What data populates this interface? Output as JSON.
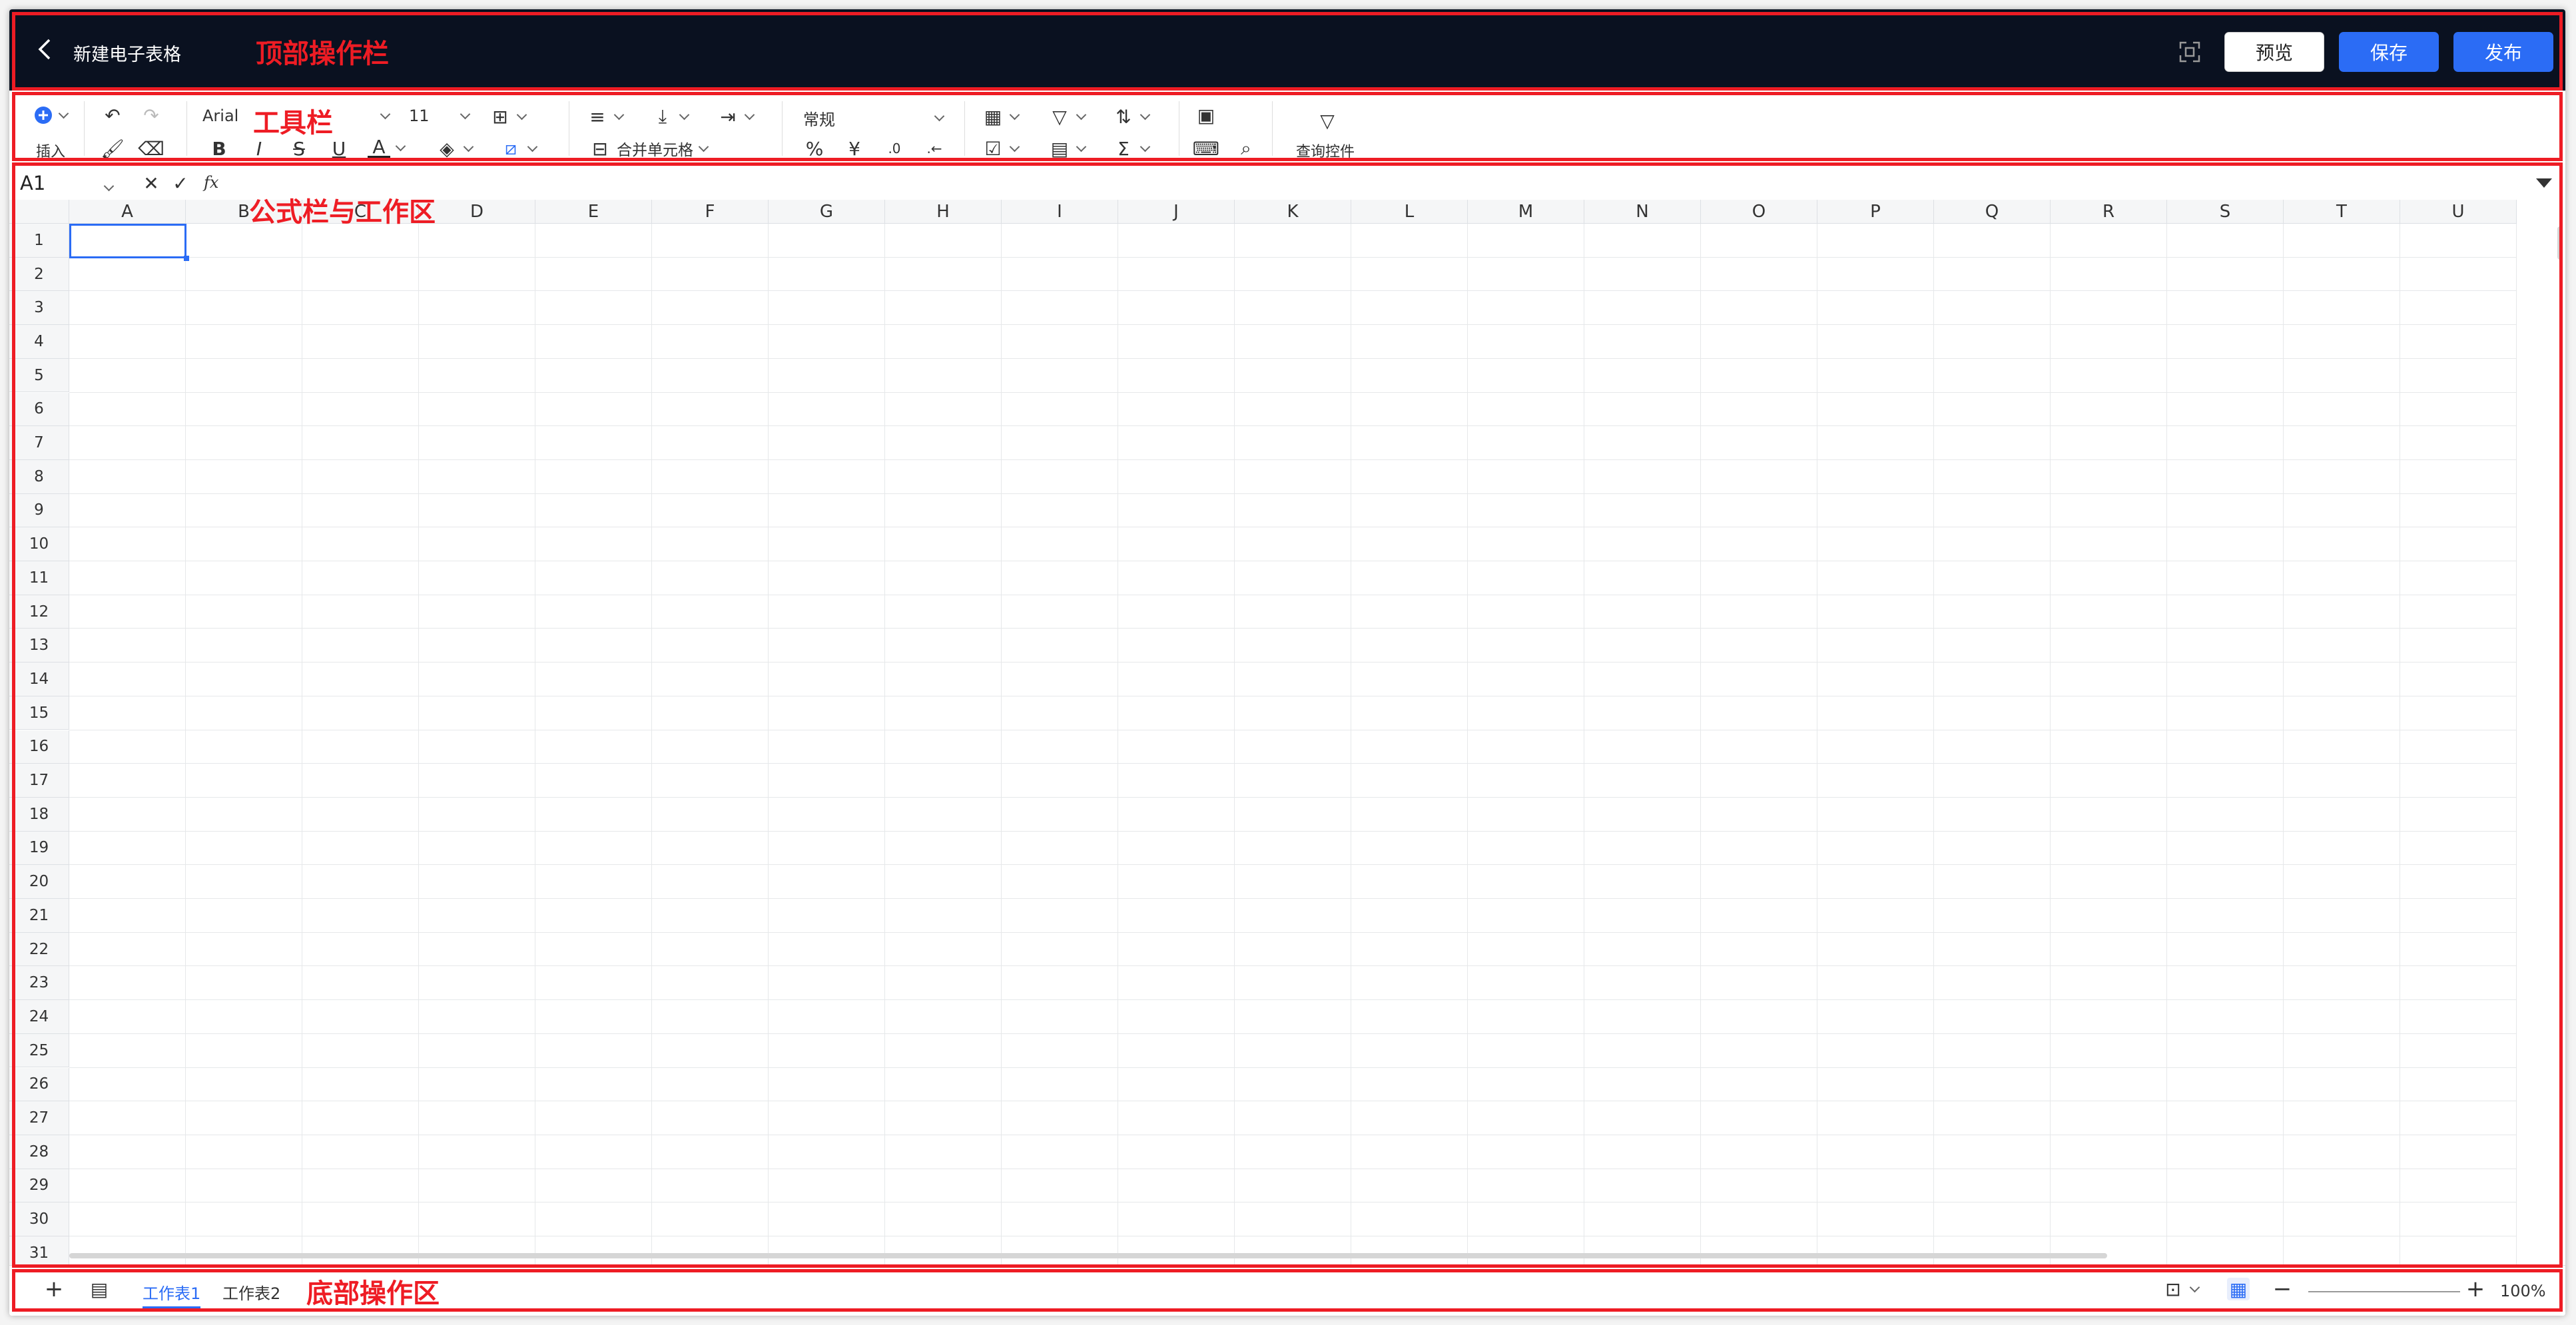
{
  "header": {
    "title": "新建电子表格",
    "preview_label": "预览",
    "save_label": "保存",
    "publish_label": "发布"
  },
  "annotations": {
    "top_bar": "顶部操作栏",
    "toolbar": "工具栏",
    "formula_work": "公式栏与工作区",
    "bottom": "底部操作区"
  },
  "toolbar": {
    "insert_label": "插入",
    "font_name": "Arial",
    "font_size": "11",
    "merge_label": "合并单元格",
    "number_format": "常规",
    "query_label": "查询控件"
  },
  "formula_bar": {
    "cell_ref": "A1",
    "fx": "fx"
  },
  "grid": {
    "columns": [
      "A",
      "B",
      "C",
      "D",
      "E",
      "F",
      "G",
      "H",
      "I",
      "J",
      "K",
      "L",
      "M",
      "N",
      "O",
      "P",
      "Q",
      "R",
      "S",
      "T",
      "U"
    ],
    "rows": [
      "1",
      "2",
      "3",
      "4",
      "5",
      "6",
      "7",
      "8",
      "9",
      "10",
      "11",
      "12",
      "13",
      "14",
      "15",
      "16",
      "17",
      "18",
      "19",
      "20",
      "21",
      "22",
      "23",
      "24",
      "25",
      "26",
      "27",
      "28",
      "29",
      "30",
      "31"
    ]
  },
  "bottom": {
    "sheets": [
      "工作表1",
      "工作表2"
    ],
    "active_sheet": "工作表1",
    "zoom": "100%"
  },
  "colors": {
    "accent": "#2b6cf5",
    "topbar_bg": "#0a1120",
    "annotation": "#ee1c24"
  }
}
